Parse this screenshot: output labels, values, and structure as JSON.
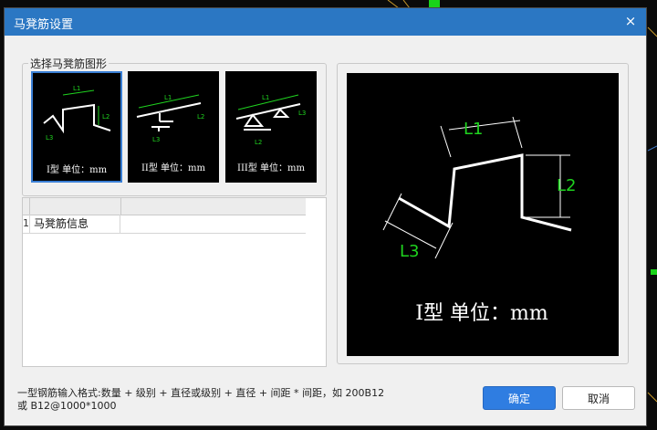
{
  "dialog": {
    "title": "马凳筋设置",
    "close_symbol": "×"
  },
  "shape_group": {
    "legend": "选择马凳筋图形",
    "options": [
      {
        "label": "I型 单位：mm",
        "selected": true
      },
      {
        "label": "II型 单位：mm",
        "selected": false
      },
      {
        "label": "III型 单位：mm",
        "selected": false
      }
    ],
    "diagram_labels": {
      "l1": "L1",
      "l2": "L2",
      "l3": "L3"
    }
  },
  "info_grid": {
    "rows": [
      {
        "index": "1",
        "label": "马凳筋信息",
        "value": ""
      }
    ]
  },
  "preview": {
    "caption": "I型 单位：mm",
    "l1": "L1",
    "l2": "L2",
    "l3": "L3"
  },
  "hint": {
    "line1": "一型钢筋输入格式:数量 + 级别 + 直径或级别 + 直径 + 间距 * 间距，如 200B12",
    "line2": "或 B12@1000*1000"
  },
  "buttons": {
    "ok": "确定",
    "cancel": "取消"
  },
  "colors": {
    "titlebar": "#2b77c3",
    "primary_button": "#2f7de1",
    "dimension_green": "#1fd31f",
    "selection_border": "#3a7fd5"
  }
}
